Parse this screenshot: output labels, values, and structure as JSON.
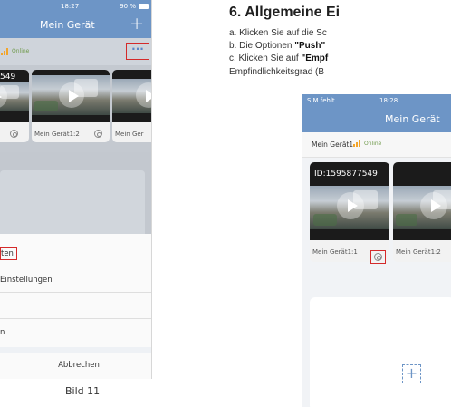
{
  "left_screenshot": {
    "status": {
      "time": "18:27",
      "battery": "90 %"
    },
    "nav": {
      "title": "Mein Gerät",
      "add_symbol": "+"
    },
    "device_row": {
      "online": "Online",
      "more_symbol": "···"
    },
    "cards": [
      {
        "id": "549",
        "name": ""
      },
      {
        "id": "",
        "name": "Mein Gerät1:2"
      },
      {
        "id": "",
        "name": "Mein Ger"
      }
    ],
    "action_sheet": {
      "items": [
        "ten",
        "Einstellungen",
        "",
        "n"
      ],
      "cancel": "Abbrechen"
    },
    "caption": "Bild 11"
  },
  "instructions": {
    "title": "6. Allgemeine Ei",
    "line_a": "a. Klicken Sie auf die Sc",
    "line_b_prefix": "b. Die Optionen ",
    "line_b_bold": "\"Push\"",
    "line_c_prefix": "c. Klicken Sie auf ",
    "line_c_bold": "\"Empf",
    "line_d": "Empfindlichkeitsgrad (B"
  },
  "right_screenshot": {
    "status": {
      "carrier": "SIM fehlt",
      "time": "18:28"
    },
    "nav": {
      "title": "Mein Gerät"
    },
    "device_row": {
      "name": "Mein Gerät1",
      "online": "Online"
    },
    "cards": [
      {
        "id": "ID:1595877549",
        "name": "Mein Gerät1:1"
      },
      {
        "id": "",
        "name": "Mein Gerät1:2"
      }
    ],
    "add_symbol": "+"
  },
  "colors": {
    "header_blue": "#6d95c6",
    "highlight_red": "#d42a2a",
    "online_green": "#6f9a4b",
    "signal_orange": "#f3a52a"
  }
}
